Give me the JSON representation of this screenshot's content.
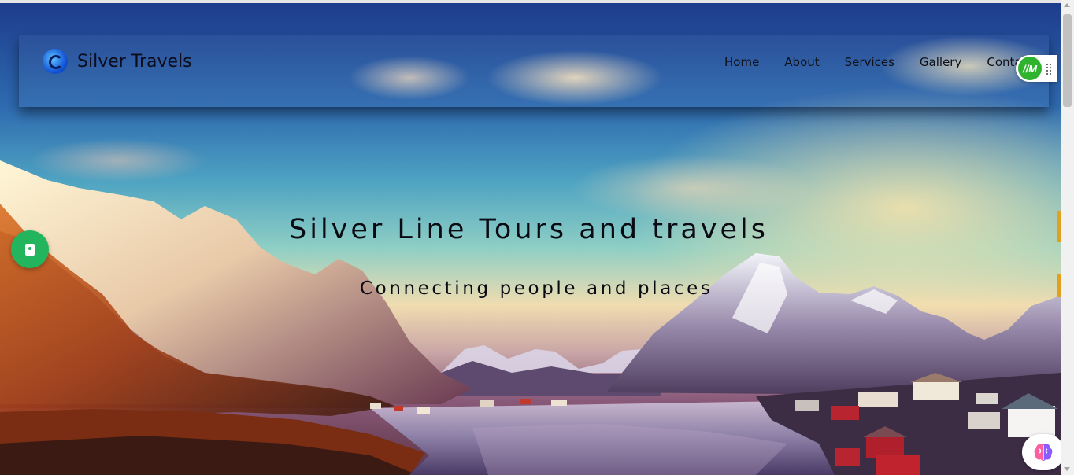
{
  "brand": {
    "name": "Silver Travels",
    "logo_icon": "globe-logo-icon"
  },
  "nav": {
    "items": [
      {
        "label": "Home"
      },
      {
        "label": "About"
      },
      {
        "label": "Services"
      },
      {
        "label": "Gallery"
      },
      {
        "label": "Contact"
      }
    ]
  },
  "hero": {
    "title": "Silver Line Tours and travels",
    "subtitle": "Connecting people and places",
    "background": "mountain-lake-village-photo"
  },
  "widgets": {
    "contact_fab_icon": "contact-card-icon",
    "contact_fab_color": "#22b55e",
    "extension_badge_text": "//M",
    "extension_badge_color": "#2fb32f",
    "ai_assistant_icon": "brain-icon"
  }
}
